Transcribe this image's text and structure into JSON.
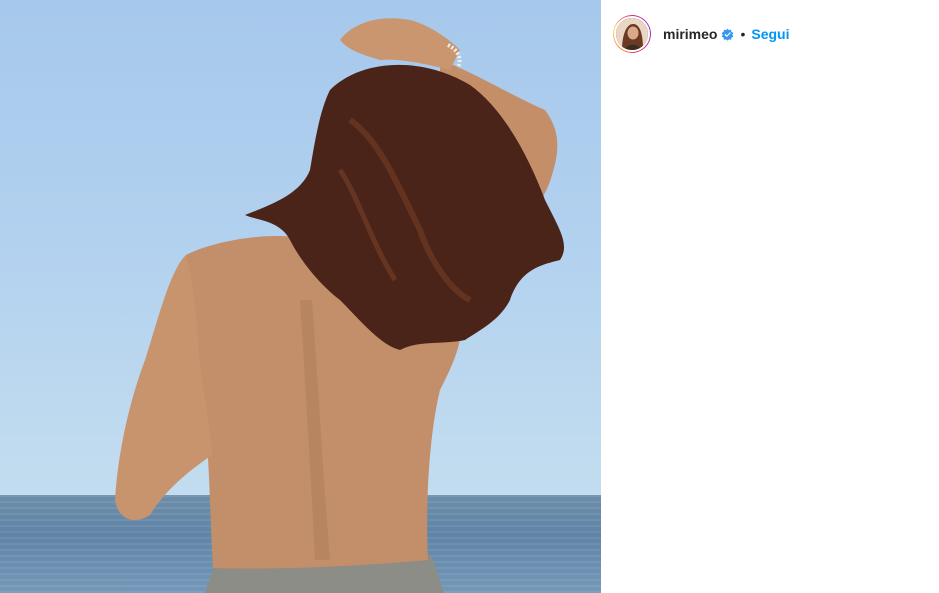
{
  "post": {
    "author": {
      "username": "mirimeo",
      "verified": true,
      "avatar_icon": "profile-photo"
    },
    "separator": "•",
    "follow_label": "Segui",
    "colors": {
      "follow": "#0095f6",
      "username": "#262626",
      "verified_badge": "#3897f0"
    },
    "media": {
      "description_icon": "photo"
    }
  }
}
